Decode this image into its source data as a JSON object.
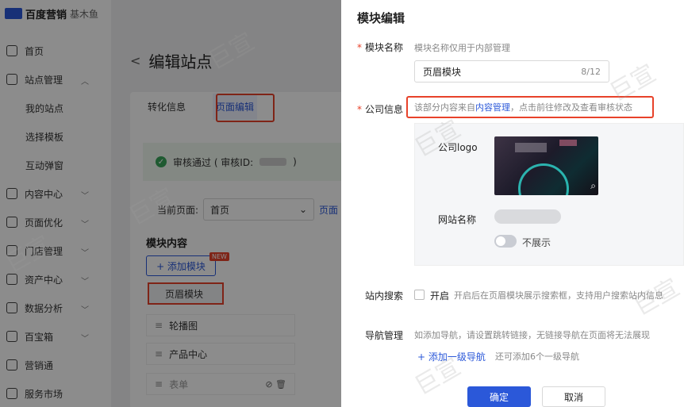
{
  "brand": {
    "name": "百度营销",
    "sub": "基木鱼"
  },
  "sidebar": {
    "items": [
      {
        "label": "首页",
        "icon": "home-icon",
        "expandable": false
      },
      {
        "label": "站点管理",
        "icon": "grid-icon",
        "expandable": true,
        "expanded": true,
        "children": [
          "我的站点",
          "选择模板",
          "互动弹窗"
        ]
      },
      {
        "label": "内容中心",
        "icon": "content-icon",
        "expandable": true
      },
      {
        "label": "页面优化",
        "icon": "optimize-icon",
        "expandable": true
      },
      {
        "label": "门店管理",
        "icon": "store-icon",
        "expandable": true
      },
      {
        "label": "资产中心",
        "icon": "asset-icon",
        "expandable": true
      },
      {
        "label": "数据分析",
        "icon": "chart-icon",
        "expandable": true
      },
      {
        "label": "百宝箱",
        "icon": "toolbox-icon",
        "expandable": true
      },
      {
        "label": "营销通",
        "icon": "marketing-icon",
        "expandable": false
      },
      {
        "label": "服务市场",
        "icon": "market-icon",
        "expandable": false
      }
    ]
  },
  "main": {
    "title": "编辑站点",
    "tabs": [
      "转化信息",
      "页面编辑"
    ],
    "active_tab": "页面编辑",
    "audit": {
      "prefix": "审核通过 ( 审核ID:",
      "suffix": ")"
    },
    "current_page": {
      "label": "当前页面:",
      "value": "首页",
      "link": "页面"
    },
    "module_head": "模块内容",
    "add_module": "+ 添加模块",
    "new_badge": "NEW",
    "modules": [
      "页眉模块",
      "轮播图",
      "产品中心",
      "表单"
    ]
  },
  "drawer": {
    "title": "模块编辑",
    "name_label": "模块名称",
    "name_hint": "模块名称仅用于内部管理",
    "name_value": "页眉模块",
    "name_count": "8/12",
    "company_label": "公司信息",
    "company_hint_prefix": "该部分内容来自",
    "company_hint_link": "内容管理",
    "company_hint_suffix": "，点击前往修改及查看审核状态",
    "logo_label": "公司logo",
    "site_name_label": "网站名称",
    "toggle_label": "不展示",
    "search_label": "站内搜索",
    "search_check": "开启",
    "search_hint": "开启后在页眉模块展示搜索框，支持用户搜索站内信息",
    "nav_label": "导航管理",
    "nav_hint": "如添加导航，请设置跳转链接，无链接导航在页面将无法展现",
    "add_nav": "+ 添加一级导航",
    "add_nav_hint": "还可添加6个一级导航",
    "ok": "确定",
    "cancel": "取消"
  },
  "watermark": "巨宣",
  "colors": {
    "accent": "#2b58d9",
    "highlight": "#e8422a",
    "success": "#3aa55a"
  }
}
